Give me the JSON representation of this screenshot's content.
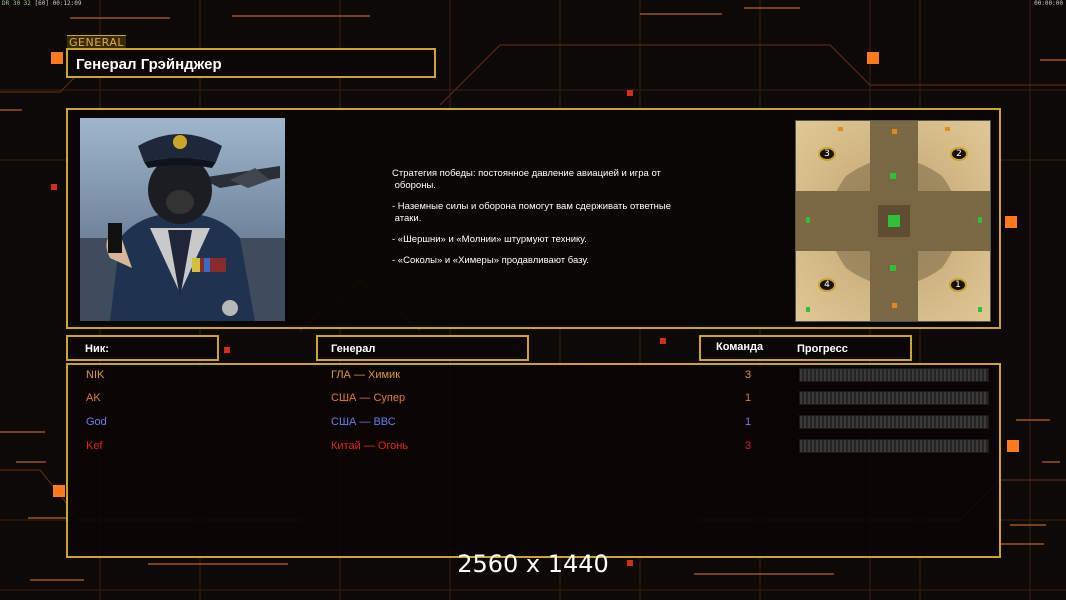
{
  "topbar": {
    "left_status": "DR 30 32",
    "left_dim": "[60]",
    "left_time": "00:12:09",
    "right_time": "00:00:00"
  },
  "header": {
    "tag": "GENERAL",
    "title": "Генерал Грэйнджер"
  },
  "briefing": {
    "lines": [
      "Стратегия победы: постоянное давление авиацией и игра от\n обороны.",
      "- Наземные силы и оборона помогут вам сдерживать ответные\n атаки.",
      "- «Шершни» и «Молнии» штурмуют технику.",
      "- «Соколы» и «Химеры» продавливают базу."
    ]
  },
  "minimap": {
    "start_positions": [
      "1",
      "2",
      "3",
      "4"
    ],
    "colors": {
      "sand": "#cfb07a",
      "road": "#6b5a3a",
      "marker_green": "#2fbf3a",
      "marker_orange": "#e08a20"
    }
  },
  "columns": {
    "nick": "Ник:",
    "general": "Генерал",
    "team": "Команда",
    "progress": "Прогресс"
  },
  "players": [
    {
      "nick": "NIK",
      "general": "ГЛА — Химик",
      "team": "3",
      "progress": 0,
      "color": "#d99a3a"
    },
    {
      "nick": "AK",
      "general": "США — Супер",
      "team": "1",
      "progress": 0,
      "color": "#e07a3a"
    },
    {
      "nick": "God",
      "general": "США — ВВС",
      "team": "1",
      "progress": 0,
      "color": "#6b7ee8"
    },
    {
      "nick": "Kef",
      "general": "Китай — Огонь",
      "team": "3",
      "progress": 0,
      "color": "#e0261c"
    }
  ],
  "footer": {
    "resolution": "2560 x 1440"
  },
  "theme": {
    "frame": "#c9a62a",
    "accent": "#ff7a1a",
    "background": "#0d0906"
  }
}
